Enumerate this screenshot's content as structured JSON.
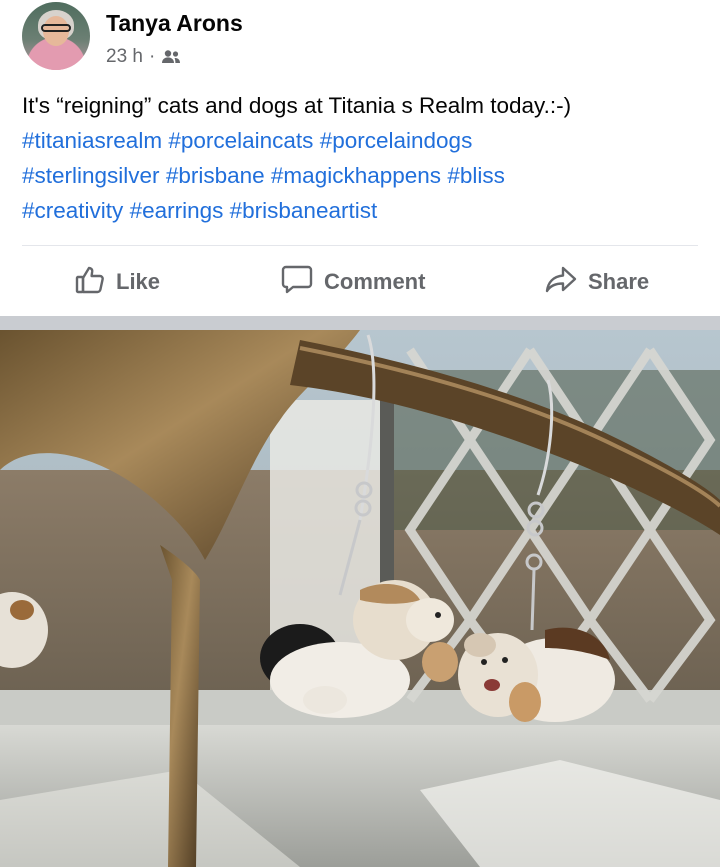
{
  "post": {
    "author": "Tanya Arons",
    "time": "23 h",
    "separator": "·",
    "audience_icon": "friends-icon",
    "text": "It's “reigning” cats and dogs at Titania s Realm today.:-)",
    "hashtags": [
      "#titaniasrealm",
      "#porcelaincats",
      "#porcelaindogs",
      "#sterlingsilver",
      "#brisbane",
      "#magickhappens",
      "#bliss",
      "#creativity",
      "#earrings",
      "#brisbaneartist"
    ]
  },
  "actions": {
    "like": "Like",
    "comment": "Comment",
    "share": "Share"
  },
  "colors": {
    "link": "#216fdb",
    "muted": "#65676b",
    "text": "#050505"
  }
}
